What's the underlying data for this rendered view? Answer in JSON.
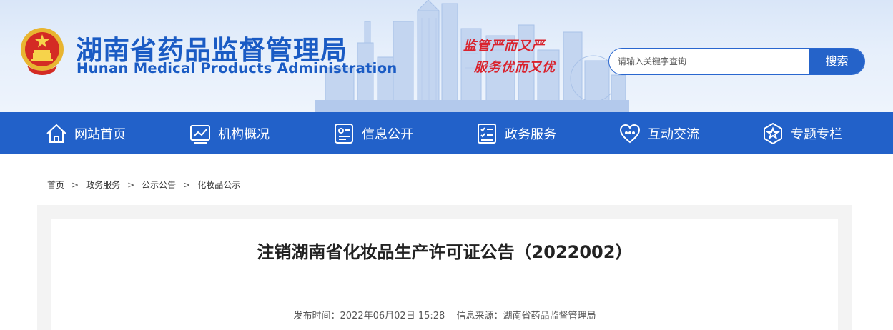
{
  "header": {
    "title_cn": "湖南省药品监督管理局",
    "title_en": "Hunan Medical Products Administration",
    "slogan_line1": "监管严而又严",
    "slogan_line2": "服务优而又优"
  },
  "search": {
    "placeholder": "请输入关键字查询",
    "button_label": "搜索"
  },
  "nav": {
    "items": [
      {
        "label": "网站首页",
        "icon": "home-icon"
      },
      {
        "label": "机构概况",
        "icon": "chart-icon"
      },
      {
        "label": "信息公开",
        "icon": "id-card-icon"
      },
      {
        "label": "政务服务",
        "icon": "checklist-icon"
      },
      {
        "label": "互动交流",
        "icon": "heart-chat-icon"
      },
      {
        "label": "专题专栏",
        "icon": "star-badge-icon"
      }
    ]
  },
  "breadcrumb": {
    "items": [
      "首页",
      "政务服务",
      "公示公告",
      "化妆品公示"
    ],
    "separator": ">"
  },
  "article": {
    "title": "注销湖南省化妆品生产许可证公告（2022002）",
    "published": "发布时间：2022年06月02日 15:28",
    "source": "信息来源：湖南省药品监督管理局"
  },
  "colors": {
    "brand_blue": "#2261c9",
    "title_blue": "#1a5bc4",
    "slogan_red": "#d9232e"
  }
}
